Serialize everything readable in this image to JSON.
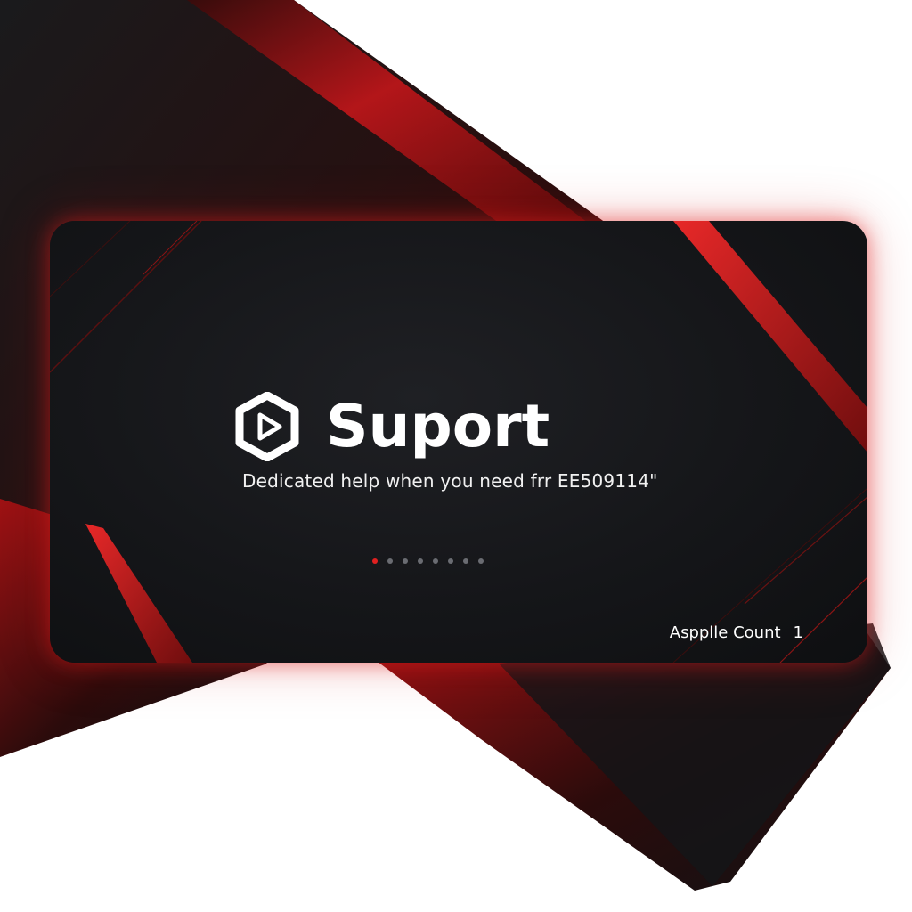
{
  "brand": {
    "title": "Suport",
    "logo_icon": "play-hexagon-icon"
  },
  "tagline": "Dedicated help when you need frr EE509114\"",
  "carousel": {
    "total": 8,
    "active_index": 0
  },
  "footer": {
    "label": "Aspplle Count",
    "count": "1"
  },
  "colors": {
    "accent": "#e02020",
    "card_bg": "#151619",
    "text": "#ffffff",
    "dot_inactive": "#6a6c72"
  }
}
